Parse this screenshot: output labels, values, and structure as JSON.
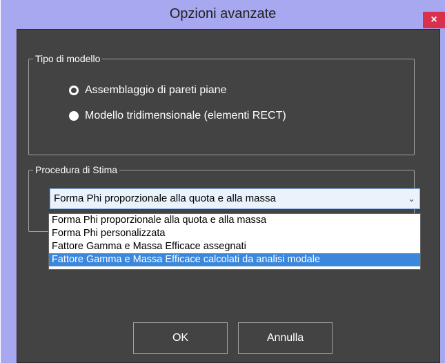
{
  "window": {
    "title": "Opzioni avanzate",
    "close_glyph": "×"
  },
  "model_type": {
    "label": "Tipo di modello",
    "options": [
      {
        "label": "Assemblaggio di pareti piane",
        "checked": true
      },
      {
        "label": "Modello tridimensionale (elementi RECT)",
        "checked": false
      }
    ]
  },
  "estimate_procedure": {
    "label": "Procedura di Stima",
    "selected": "Forma Phi proporzionale alla quota e alla massa",
    "dropdown_icon": "chevron-down-icon",
    "options": [
      "Forma Phi proporzionale alla quota e alla massa",
      "Forma Phi personalizzata",
      "Fattore Gamma e Massa Efficace assegnati",
      "Fattore Gamma e Massa Efficace calcolati da analisi modale"
    ],
    "highlighted_index": 3
  },
  "buttons": {
    "ok": "OK",
    "cancel": "Annulla"
  },
  "colors": {
    "title_bar": "#a8a8f0",
    "client_background": "#434343",
    "close_button": "#d9304e",
    "selection": "#3a87dc"
  }
}
